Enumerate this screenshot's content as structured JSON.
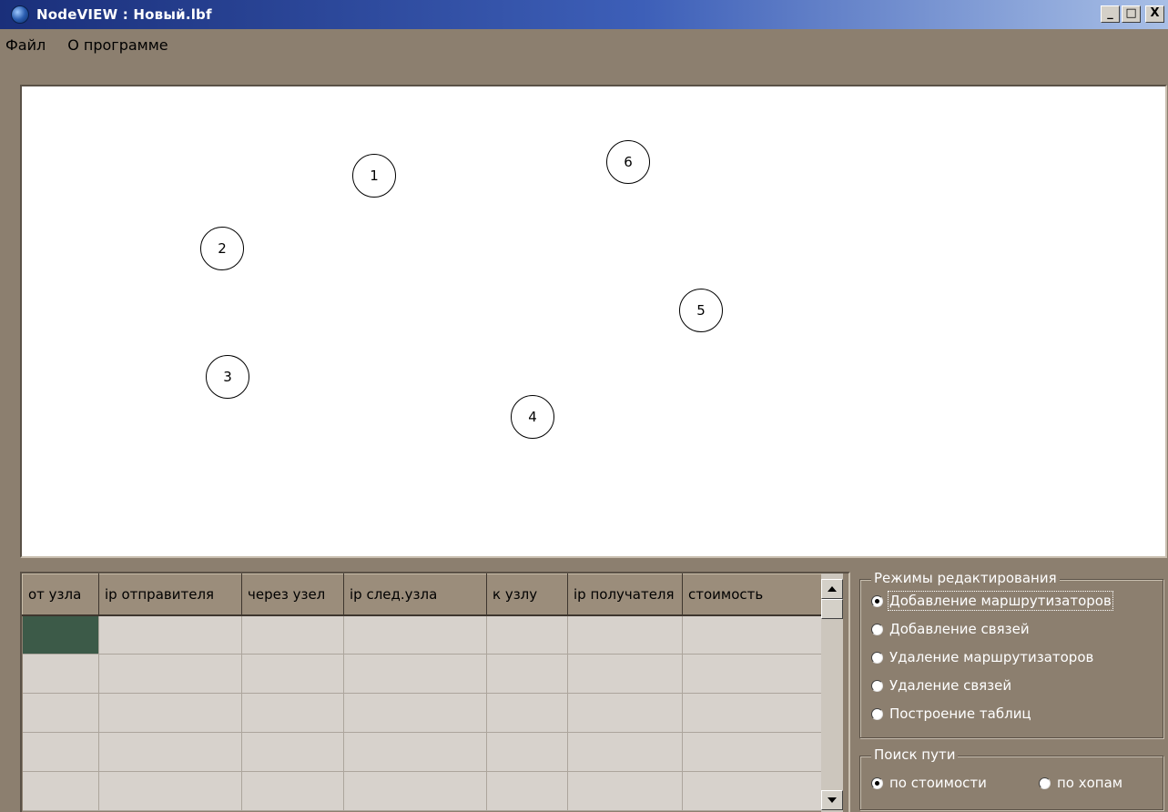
{
  "window": {
    "title": "NodeVIEW : Новый.lbf",
    "minimize_label": "_",
    "maximize_label": "□",
    "close_label": "X"
  },
  "menu": {
    "items": [
      "Файл",
      "О программе"
    ]
  },
  "canvas": {
    "nodes": [
      "1",
      "2",
      "3",
      "4",
      "5",
      "6"
    ]
  },
  "table": {
    "columns": [
      "от узла",
      "ip отправителя",
      "через узел",
      "ip след.узла",
      "к узлу",
      "ip получателя",
      "стоимость"
    ],
    "row_count": 5,
    "selected_cell": "row 1, column 1"
  },
  "edit_modes": {
    "title": "Режимы редактирования",
    "options": [
      "Добавление маршрутизаторов",
      "Добавление связей",
      "Удаление маршрутизаторов",
      "Удаление связей",
      "Построение таблиц"
    ],
    "selected": "Добавление маршрутизаторов"
  },
  "path_search": {
    "title": "Поиск пути",
    "options": [
      "по стоимости",
      "по хопам"
    ],
    "selected": "по стоимости"
  },
  "colors": {
    "window_bg": "#8c7f6f",
    "title_gradient_start": "#1a2f7a",
    "title_gradient_end": "#a8bfe6",
    "grid_cell": "#d7d2cc",
    "grid_selected": "#3c5a48"
  },
  "icons": {
    "app": "globe-icon",
    "scroll_up": "arrow-up-icon",
    "scroll_down": "arrow-down-icon"
  }
}
